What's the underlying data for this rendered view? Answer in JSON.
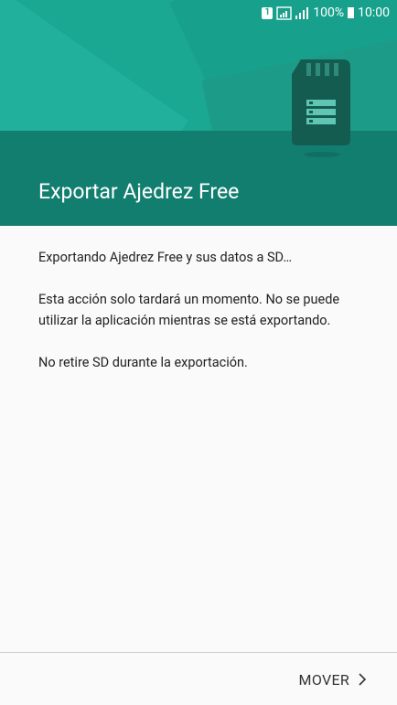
{
  "status_bar": {
    "sim_slot": "1",
    "battery_text": "100%",
    "time": "10:00"
  },
  "header": {
    "title": "Exportar Ajedrez Free",
    "illustration_icon": "sd-card-icon"
  },
  "content": {
    "paragraph_1": "Exportando Ajedrez Free y sus datos a SD…",
    "paragraph_2": "Esta acción solo tardará un momento. No se puede utilizar la aplicación mientras se está exportando.",
    "paragraph_3": "No retire SD durante la exportación."
  },
  "footer": {
    "next_label": "MOVER",
    "next_icon": "chevron-right-icon"
  },
  "colors": {
    "header_light": "#1aa893",
    "header_dark": "#127e6f",
    "background": "#fafafa",
    "sd_card": "#155c50"
  }
}
